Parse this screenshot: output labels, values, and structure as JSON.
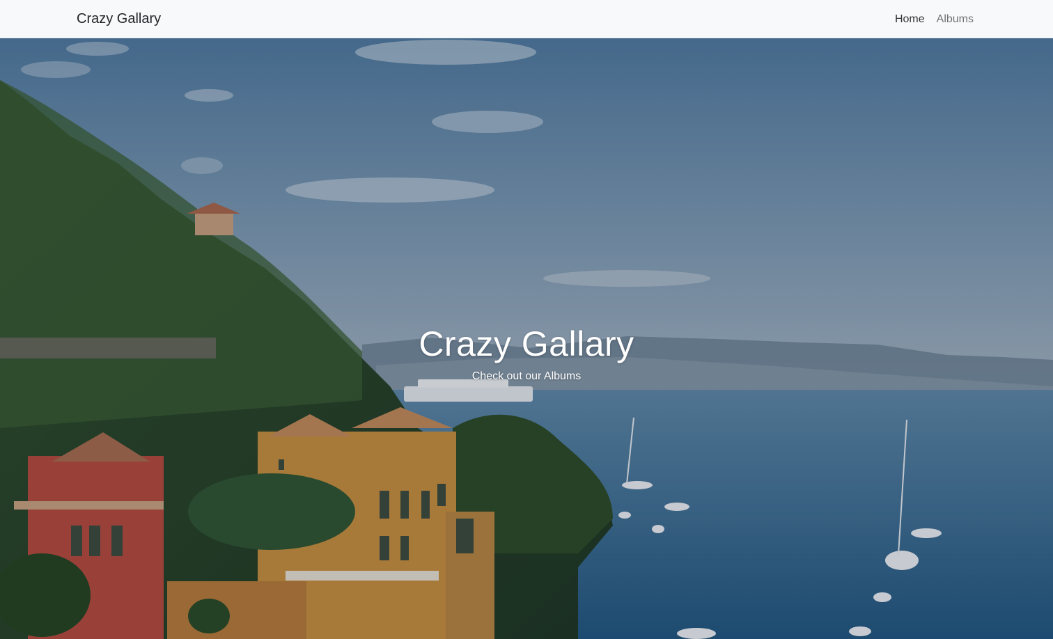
{
  "navbar": {
    "brand": "Crazy Gallary",
    "links": [
      {
        "label": "Home",
        "active": true
      },
      {
        "label": "Albums",
        "active": false
      }
    ],
    "background": "#f8f9fa"
  },
  "hero": {
    "title": "Crazy Gallary",
    "subtitle": "Check out our Albums",
    "text_color": "#ffffff"
  }
}
